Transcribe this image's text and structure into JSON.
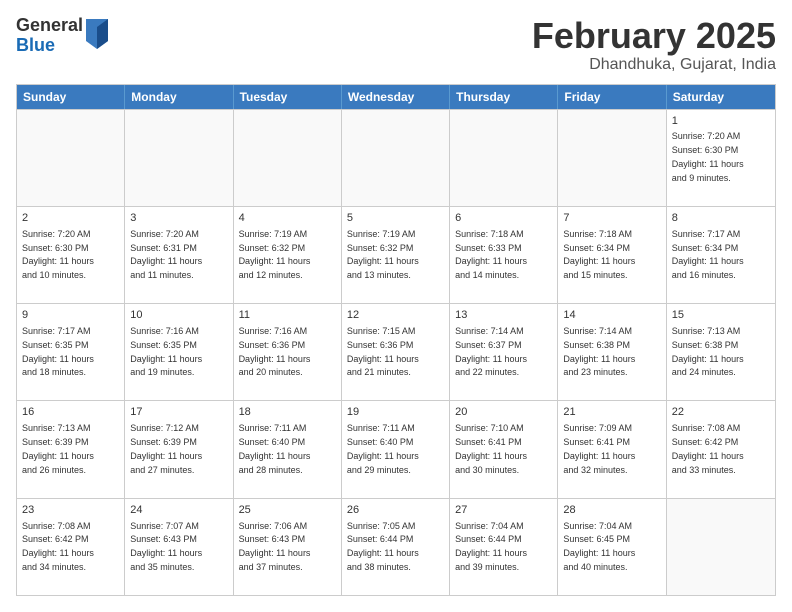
{
  "logo": {
    "general": "General",
    "blue": "Blue"
  },
  "title": "February 2025",
  "location": "Dhandhuka, Gujarat, India",
  "days": [
    "Sunday",
    "Monday",
    "Tuesday",
    "Wednesday",
    "Thursday",
    "Friday",
    "Saturday"
  ],
  "rows": [
    [
      {
        "date": "",
        "info": ""
      },
      {
        "date": "",
        "info": ""
      },
      {
        "date": "",
        "info": ""
      },
      {
        "date": "",
        "info": ""
      },
      {
        "date": "",
        "info": ""
      },
      {
        "date": "",
        "info": ""
      },
      {
        "date": "1",
        "info": "Sunrise: 7:20 AM\nSunset: 6:30 PM\nDaylight: 11 hours\nand 9 minutes."
      }
    ],
    [
      {
        "date": "2",
        "info": "Sunrise: 7:20 AM\nSunset: 6:30 PM\nDaylight: 11 hours\nand 10 minutes."
      },
      {
        "date": "3",
        "info": "Sunrise: 7:20 AM\nSunset: 6:31 PM\nDaylight: 11 hours\nand 11 minutes."
      },
      {
        "date": "4",
        "info": "Sunrise: 7:19 AM\nSunset: 6:32 PM\nDaylight: 11 hours\nand 12 minutes."
      },
      {
        "date": "5",
        "info": "Sunrise: 7:19 AM\nSunset: 6:32 PM\nDaylight: 11 hours\nand 13 minutes."
      },
      {
        "date": "6",
        "info": "Sunrise: 7:18 AM\nSunset: 6:33 PM\nDaylight: 11 hours\nand 14 minutes."
      },
      {
        "date": "7",
        "info": "Sunrise: 7:18 AM\nSunset: 6:34 PM\nDaylight: 11 hours\nand 15 minutes."
      },
      {
        "date": "8",
        "info": "Sunrise: 7:17 AM\nSunset: 6:34 PM\nDaylight: 11 hours\nand 16 minutes."
      }
    ],
    [
      {
        "date": "9",
        "info": "Sunrise: 7:17 AM\nSunset: 6:35 PM\nDaylight: 11 hours\nand 18 minutes."
      },
      {
        "date": "10",
        "info": "Sunrise: 7:16 AM\nSunset: 6:35 PM\nDaylight: 11 hours\nand 19 minutes."
      },
      {
        "date": "11",
        "info": "Sunrise: 7:16 AM\nSunset: 6:36 PM\nDaylight: 11 hours\nand 20 minutes."
      },
      {
        "date": "12",
        "info": "Sunrise: 7:15 AM\nSunset: 6:36 PM\nDaylight: 11 hours\nand 21 minutes."
      },
      {
        "date": "13",
        "info": "Sunrise: 7:14 AM\nSunset: 6:37 PM\nDaylight: 11 hours\nand 22 minutes."
      },
      {
        "date": "14",
        "info": "Sunrise: 7:14 AM\nSunset: 6:38 PM\nDaylight: 11 hours\nand 23 minutes."
      },
      {
        "date": "15",
        "info": "Sunrise: 7:13 AM\nSunset: 6:38 PM\nDaylight: 11 hours\nand 24 minutes."
      }
    ],
    [
      {
        "date": "16",
        "info": "Sunrise: 7:13 AM\nSunset: 6:39 PM\nDaylight: 11 hours\nand 26 minutes."
      },
      {
        "date": "17",
        "info": "Sunrise: 7:12 AM\nSunset: 6:39 PM\nDaylight: 11 hours\nand 27 minutes."
      },
      {
        "date": "18",
        "info": "Sunrise: 7:11 AM\nSunset: 6:40 PM\nDaylight: 11 hours\nand 28 minutes."
      },
      {
        "date": "19",
        "info": "Sunrise: 7:11 AM\nSunset: 6:40 PM\nDaylight: 11 hours\nand 29 minutes."
      },
      {
        "date": "20",
        "info": "Sunrise: 7:10 AM\nSunset: 6:41 PM\nDaylight: 11 hours\nand 30 minutes."
      },
      {
        "date": "21",
        "info": "Sunrise: 7:09 AM\nSunset: 6:41 PM\nDaylight: 11 hours\nand 32 minutes."
      },
      {
        "date": "22",
        "info": "Sunrise: 7:08 AM\nSunset: 6:42 PM\nDaylight: 11 hours\nand 33 minutes."
      }
    ],
    [
      {
        "date": "23",
        "info": "Sunrise: 7:08 AM\nSunset: 6:42 PM\nDaylight: 11 hours\nand 34 minutes."
      },
      {
        "date": "24",
        "info": "Sunrise: 7:07 AM\nSunset: 6:43 PM\nDaylight: 11 hours\nand 35 minutes."
      },
      {
        "date": "25",
        "info": "Sunrise: 7:06 AM\nSunset: 6:43 PM\nDaylight: 11 hours\nand 37 minutes."
      },
      {
        "date": "26",
        "info": "Sunrise: 7:05 AM\nSunset: 6:44 PM\nDaylight: 11 hours\nand 38 minutes."
      },
      {
        "date": "27",
        "info": "Sunrise: 7:04 AM\nSunset: 6:44 PM\nDaylight: 11 hours\nand 39 minutes."
      },
      {
        "date": "28",
        "info": "Sunrise: 7:04 AM\nSunset: 6:45 PM\nDaylight: 11 hours\nand 40 minutes."
      },
      {
        "date": "",
        "info": ""
      }
    ]
  ]
}
